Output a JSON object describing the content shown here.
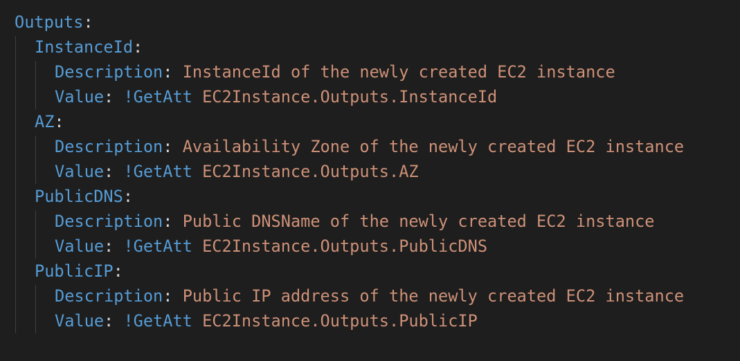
{
  "lines": [
    {
      "indent": 0,
      "key": "Outputs",
      "colon": ":",
      "tag": "",
      "value": ""
    },
    {
      "indent": 1,
      "key": "InstanceId",
      "colon": ":",
      "tag": "",
      "value": ""
    },
    {
      "indent": 2,
      "key": "Description",
      "colon": ": ",
      "tag": "",
      "value": "InstanceId of the newly created EC2 instance"
    },
    {
      "indent": 2,
      "key": "Value",
      "colon": ": ",
      "tag": "!GetAtt",
      "value": " EC2Instance.Outputs.InstanceId"
    },
    {
      "indent": 1,
      "key": "AZ",
      "colon": ":",
      "tag": "",
      "value": ""
    },
    {
      "indent": 2,
      "key": "Description",
      "colon": ": ",
      "tag": "",
      "value": "Availability Zone of the newly created EC2 instance"
    },
    {
      "indent": 2,
      "key": "Value",
      "colon": ": ",
      "tag": "!GetAtt",
      "value": " EC2Instance.Outputs.AZ"
    },
    {
      "indent": 1,
      "key": "PublicDNS",
      "colon": ":",
      "tag": "",
      "value": ""
    },
    {
      "indent": 2,
      "key": "Description",
      "colon": ": ",
      "tag": "",
      "value": "Public DNSName of the newly created EC2 instance"
    },
    {
      "indent": 2,
      "key": "Value",
      "colon": ": ",
      "tag": "!GetAtt",
      "value": " EC2Instance.Outputs.PublicDNS"
    },
    {
      "indent": 1,
      "key": "PublicIP",
      "colon": ":",
      "tag": "",
      "value": ""
    },
    {
      "indent": 2,
      "key": "Description",
      "colon": ": ",
      "tag": "",
      "value": "Public IP address of the newly created EC2 instance"
    },
    {
      "indent": 2,
      "key": "Value",
      "colon": ": ",
      "tag": "!GetAtt",
      "value": " EC2Instance.Outputs.PublicIP"
    }
  ],
  "colors": {
    "background": "#1e1e1e",
    "key": "#569cd6",
    "string": "#ce9178",
    "punctuation": "#d4d4d4",
    "indent_guide": "#404040"
  }
}
